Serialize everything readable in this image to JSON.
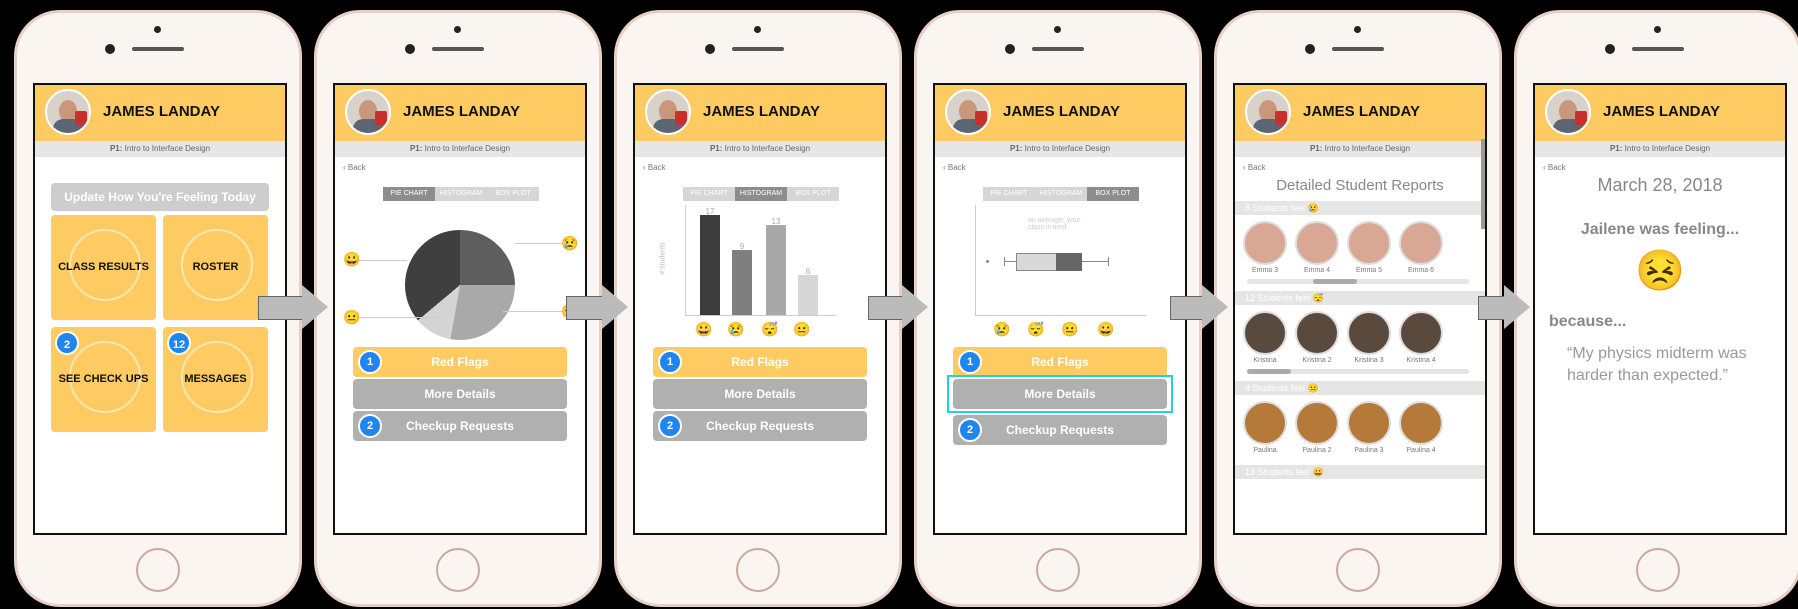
{
  "header": {
    "name": "JAMES LANDAY"
  },
  "course": {
    "prefix": "P1:",
    "title": " Intro to Interface Design"
  },
  "nav": {
    "back": "Back"
  },
  "screen1": {
    "update_button": "Update How You're Feeling Today",
    "tiles": [
      {
        "label": "CLASS RESULTS"
      },
      {
        "label": "ROSTER"
      },
      {
        "label": "SEE CHECK UPS",
        "badge": "2"
      },
      {
        "label": "MESSAGES",
        "badge": "12"
      }
    ]
  },
  "tabs": {
    "pie": "PIE CHART",
    "hist": "HISTOGRAM",
    "box": "BOX PLOT"
  },
  "actions": {
    "red_flags": "Red Flags",
    "red_flags_badge": "1",
    "more_details": "More Details",
    "checkup": "Checkup Requests",
    "checkup_badge": "2"
  },
  "histogram": {
    "ylabel": "# students",
    "values": [
      "17",
      "9",
      "13",
      "6"
    ],
    "emojis": [
      "😀",
      "😢",
      "😴",
      "😐"
    ]
  },
  "boxplot": {
    "note": "on average, your class is tired",
    "emojis": [
      "😢",
      "😴",
      "😐",
      "😀"
    ]
  },
  "pie_emojis": [
    "😀",
    "😐",
    "😢",
    "😴"
  ],
  "reports": {
    "title": "Detailed Student Reports",
    "groups": [
      {
        "header": "8 Students feel 😢",
        "names": [
          "Emma 3",
          "Emma 4",
          "Emma 5",
          "Emma 6"
        ]
      },
      {
        "header": "12 Students feel 😴",
        "names": [
          "Kristina",
          "Kristina 2",
          "Kristina 3",
          "Kristina 4"
        ]
      },
      {
        "header": "4 Students feel 😐",
        "names": [
          "Paulina",
          "Paulina 2",
          "Paulina 3",
          "Paulina 4"
        ]
      },
      {
        "header": "13 Students feel 😀"
      }
    ]
  },
  "message": {
    "date": "March 28, 2018",
    "feeling_line": "Jailene was feeling...",
    "emoji": "😣",
    "because": "because...",
    "quote": "“My physics midterm was harder than expected.”"
  },
  "colors": {
    "accent": "#fecb62",
    "badge": "#1f86f0",
    "highlight": "#22d3d8"
  }
}
